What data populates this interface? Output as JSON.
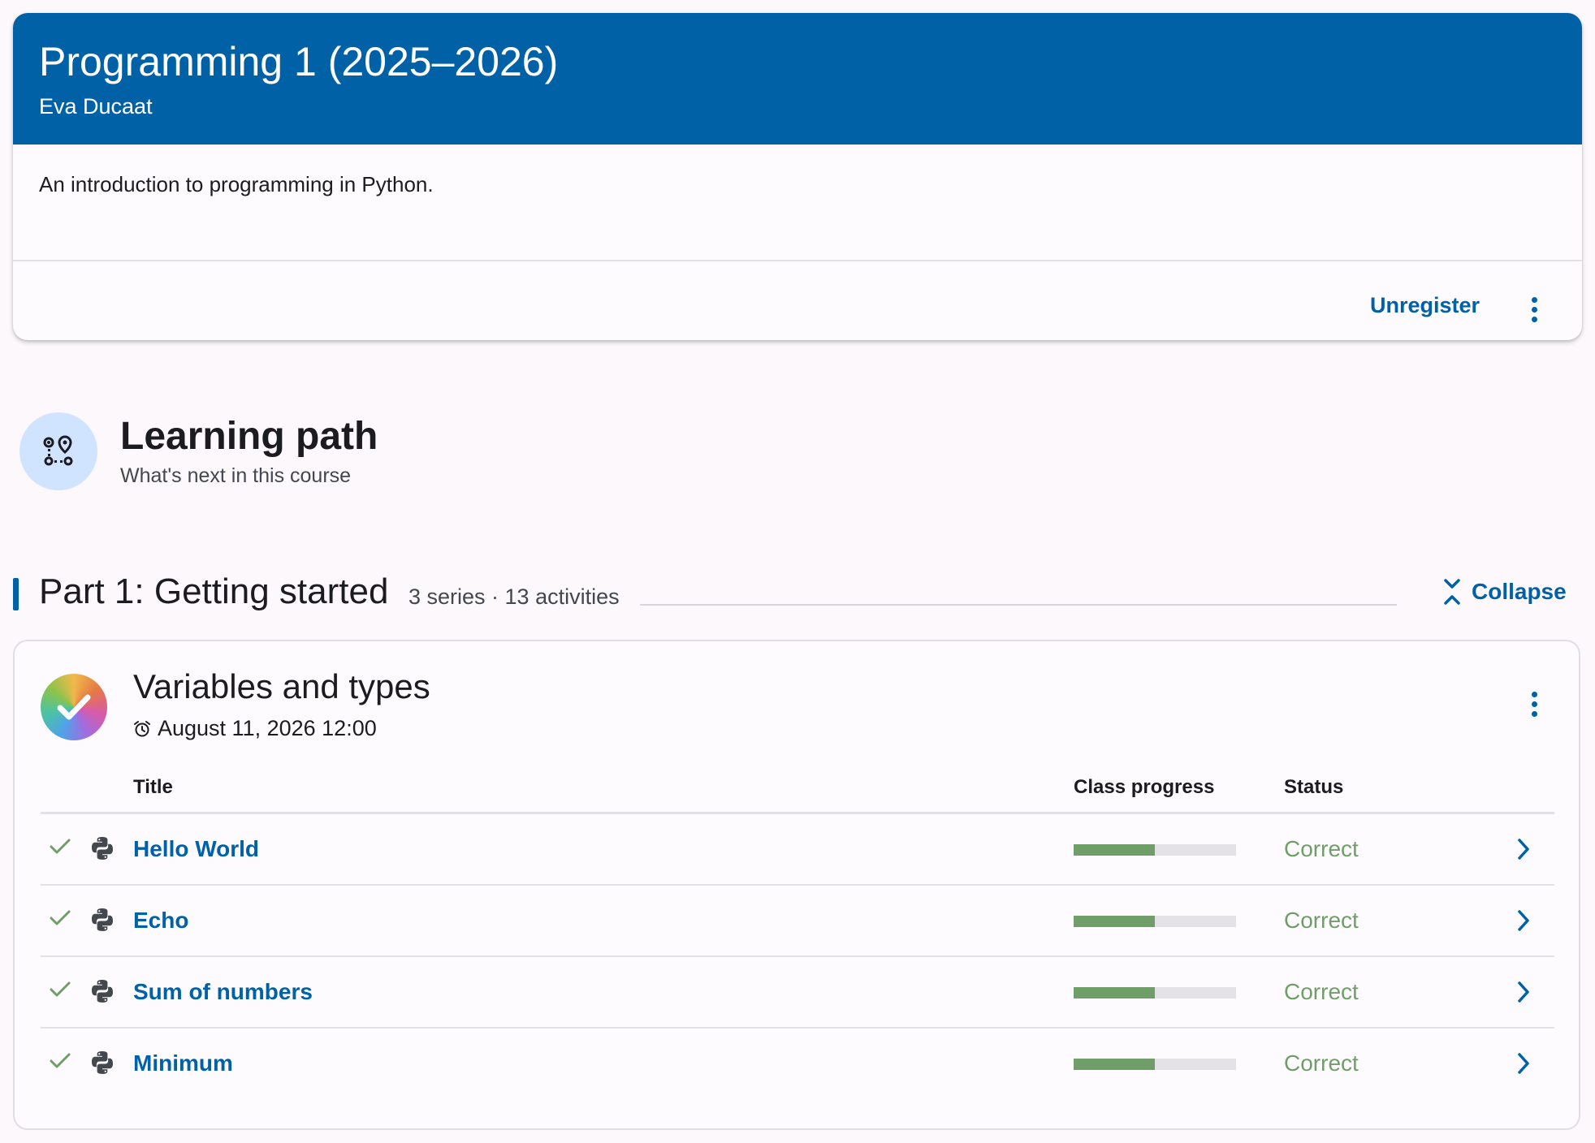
{
  "course": {
    "title": "Programming 1 (2025–2026)",
    "teacher": "Eva Ducaat",
    "description": "An introduction to programming in Python.",
    "unregister_label": "Unregister",
    "menu_icon": "more-vert-icon"
  },
  "learning_path": {
    "icon": "route-icon",
    "title": "Learning path",
    "subtitle": "What's next in this course"
  },
  "part": {
    "title": "Part 1: Getting started",
    "meta": "3 series · 13 activities",
    "collapse_label": "Collapse",
    "collapse_icon": "unfold-less-icon"
  },
  "series": {
    "title": "Variables and types",
    "deadline": "August 11, 2026 12:00",
    "deadline_icon": "alarm-icon",
    "status_icon": "check-circle-rainbow-icon",
    "columns": {
      "title": "Title",
      "class_progress": "Class progress",
      "status": "Status"
    },
    "activities": [
      {
        "title": "Hello World",
        "status": "Correct",
        "class_progress": 0.5
      },
      {
        "title": "Echo",
        "status": "Correct",
        "class_progress": 0.5
      },
      {
        "title": "Sum of numbers",
        "status": "Correct",
        "class_progress": 0.5
      },
      {
        "title": "Minimum",
        "status": "Correct",
        "class_progress": 0.5
      }
    ]
  },
  "colors": {
    "primary": "#0061a6",
    "correct": "#709e68",
    "background": "#fcf8fc"
  }
}
